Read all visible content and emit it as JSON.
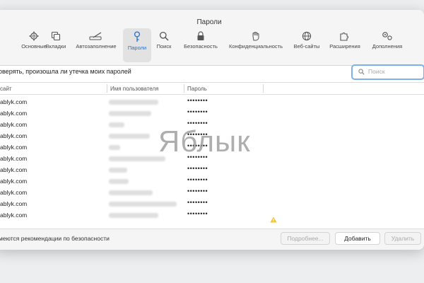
{
  "window": {
    "title": "Пароли"
  },
  "toolbar": {
    "items": [
      {
        "label": "Основные",
        "icon": "gear-icon"
      },
      {
        "label": "Вкладки",
        "icon": "tabs-icon"
      },
      {
        "label": "Автозаполнение",
        "icon": "autofill-pen-icon"
      },
      {
        "label": "Пароли",
        "icon": "key-icon",
        "active": true
      },
      {
        "label": "Поиск",
        "icon": "search-icon"
      },
      {
        "label": "Безопасность",
        "icon": "lock-icon"
      },
      {
        "label": "Конфиденциальность",
        "icon": "hand-icon"
      },
      {
        "label": "Веб-сайты",
        "icon": "globe-icon"
      },
      {
        "label": "Расширения",
        "icon": "puzzle-icon"
      },
      {
        "label": "Дополнения",
        "icon": "gears-icon"
      }
    ]
  },
  "options": {
    "leak_check_label": "оверять, произошла ли утечка моих паролей"
  },
  "search": {
    "placeholder": "Поиск"
  },
  "table": {
    "headers": [
      "сайт",
      "Имя пользователя",
      "Пароль"
    ],
    "rows": [
      {
        "site": "ablyk.com",
        "password": "••••••••"
      },
      {
        "site": "ablyk.com",
        "password": "••••••••"
      },
      {
        "site": "ablyk.com",
        "password": "••••••••"
      },
      {
        "site": "ablyk.com",
        "password": "••••••••"
      },
      {
        "site": "ablyk.com",
        "password": "••••••••"
      },
      {
        "site": "ablyk.com",
        "password": "••••••••"
      },
      {
        "site": "ablyk.com",
        "password": "••••••••"
      },
      {
        "site": "ablyk.com",
        "password": "••••••••"
      },
      {
        "site": "ablyk.com",
        "password": "••••••••"
      },
      {
        "site": "ablyk.com",
        "password": "••••••••"
      },
      {
        "site": "ablyk.com",
        "password": "••••••••"
      }
    ]
  },
  "footer": {
    "note": "меются рекомендации по безопасности",
    "details_label": "Подробнее...",
    "add_label": "Добавить",
    "delete_label": "Удалить"
  },
  "watermark": "Яблык",
  "colors": {
    "accent": "#1f6fd6",
    "warning": "#f2c230"
  }
}
